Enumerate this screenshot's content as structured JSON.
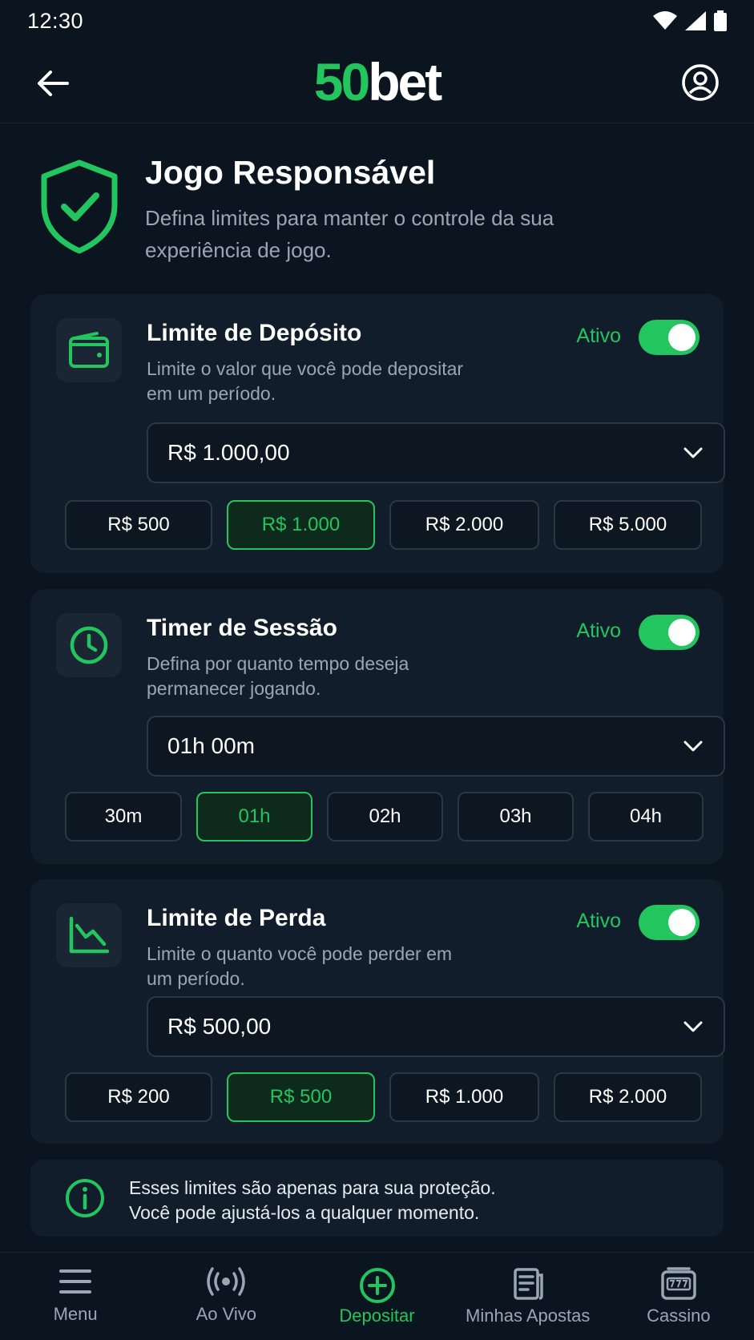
{
  "status_bar": {
    "time": "12:30"
  },
  "header": {
    "logo_number": "50",
    "logo_word": "bet"
  },
  "hero": {
    "title": "Jogo Responsável",
    "subtitle": "Defina limites para manter o controle da sua experiência de jogo."
  },
  "cards": [
    {
      "title": "Limite de Depósito",
      "description": "Limite o valor que você pode depositar em um período.",
      "status": "Ativo",
      "enabled": true,
      "icon": "wallet-icon",
      "selected_value": "R$ 1.000,00",
      "options": [
        "R$ 500",
        "R$ 1.000",
        "R$ 2.000",
        "R$ 5.000"
      ],
      "active_option": "R$ 1.000"
    },
    {
      "title": "Timer de Sessão",
      "description": "Defina por quanto tempo deseja permanecer jogando.",
      "status": "Ativo",
      "enabled": true,
      "icon": "clock-icon",
      "selected_value": "01h 00m",
      "options": [
        "30m",
        "01h",
        "02h",
        "03h",
        "04h"
      ],
      "active_option": "01h"
    },
    {
      "title": "Limite de Perda",
      "description": "Limite o quanto você pode perder em um período.",
      "status": "Ativo",
      "enabled": true,
      "icon": "chart-down-icon",
      "selected_value": "R$ 500,00",
      "options": [
        "R$ 200",
        "R$ 500",
        "R$ 1.000",
        "R$ 2.000"
      ],
      "active_option": "R$ 500"
    }
  ],
  "info": {
    "line1": "Esses limites são apenas para sua proteção.",
    "line2": "Você pode ajustá-los a qualquer momento."
  },
  "bottom_nav": [
    {
      "label": "Menu",
      "icon": "menu-icon"
    },
    {
      "label": "Ao Vivo",
      "icon": "live-icon"
    },
    {
      "label": "Depositar",
      "icon": "plus-circle-icon",
      "active": true
    },
    {
      "label": "Minhas Apostas",
      "icon": "bets-icon"
    },
    {
      "label": "Cassino",
      "icon": "slot-icon"
    }
  ],
  "colors": {
    "accent": "#22c55e",
    "background": "#0a1520",
    "card": "#111d2a"
  }
}
